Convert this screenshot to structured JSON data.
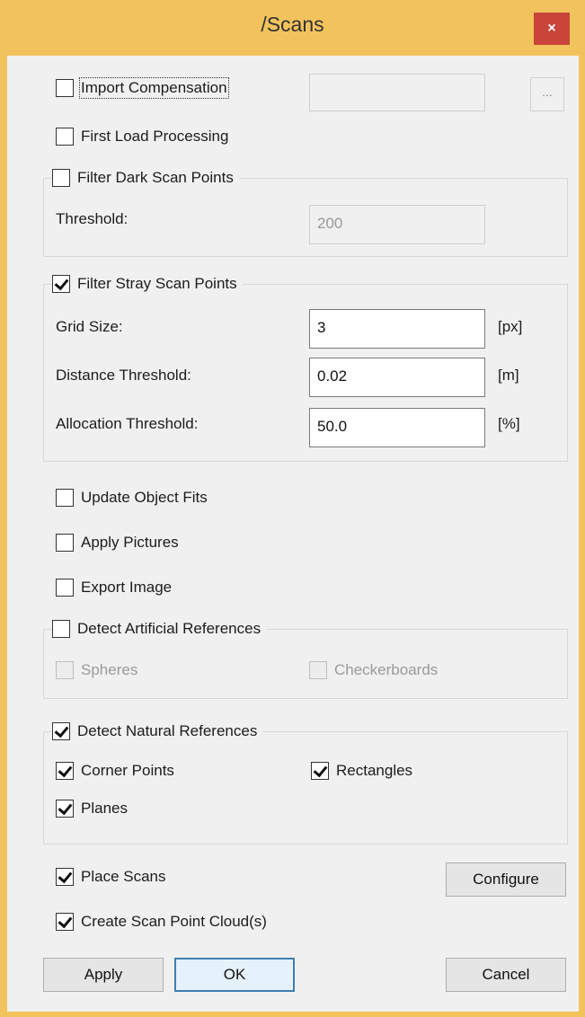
{
  "window": {
    "title": "/Scans",
    "close_label": "×"
  },
  "import_compensation": {
    "label": "Import Compensation",
    "checked": false,
    "path_value": "",
    "browse_label": "..."
  },
  "first_load_processing": {
    "label": "First Load Processing",
    "checked": false
  },
  "filter_dark": {
    "label": "Filter Dark Scan Points",
    "checked": false,
    "threshold_label": "Threshold:",
    "threshold_value": "200"
  },
  "filter_stray": {
    "label": "Filter Stray Scan Points",
    "checked": true,
    "grid_size_label": "Grid Size:",
    "grid_size_value": "3",
    "grid_size_unit": "[px]",
    "distance_label": "Distance Threshold:",
    "distance_value": "0.02",
    "distance_unit": "[m]",
    "allocation_label": "Allocation Threshold:",
    "allocation_value": "50.0",
    "allocation_unit": "[%]"
  },
  "update_object_fits": {
    "label": "Update Object Fits",
    "checked": false
  },
  "apply_pictures": {
    "label": "Apply Pictures",
    "checked": false
  },
  "export_image": {
    "label": "Export Image",
    "checked": false
  },
  "artificial_refs": {
    "label": "Detect Artificial References",
    "checked": false,
    "spheres_label": "Spheres",
    "checkerboards_label": "Checkerboards"
  },
  "natural_refs": {
    "label": "Detect Natural References",
    "checked": true,
    "corner_points_label": "Corner Points",
    "rectangles_label": "Rectangles",
    "planes_label": "Planes"
  },
  "place_scans": {
    "label": "Place Scans",
    "checked": true,
    "configure_label": "Configure"
  },
  "create_cloud": {
    "label": "Create Scan Point Cloud(s)",
    "checked": true
  },
  "buttons": {
    "apply": "Apply",
    "ok": "OK",
    "cancel": "Cancel"
  }
}
